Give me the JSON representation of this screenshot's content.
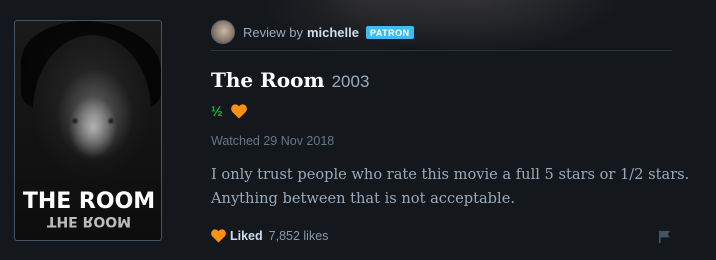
{
  "poster": {
    "title": "THE ROOM",
    "mirrored_title": "THE ROOM"
  },
  "review": {
    "by_label": "Review by",
    "reviewer": "michelle",
    "badge": "PATRON",
    "film_title": "The Room",
    "film_year": "2003",
    "rating_text": "½",
    "rating_stars": 0.5,
    "liked_icon": "heart-icon",
    "watched": "Watched 29 Nov 2018",
    "body": "I only trust people who rate this movie a full 5 stars or 1/2 stars. Anything between that is not acceptable.",
    "liked_label": "Liked",
    "likes": "7,852 likes",
    "report_icon": "flag-icon"
  },
  "colors": {
    "background": "#14181c",
    "accent_green": "#00c030",
    "accent_orange": "#ff9010",
    "patron_badge": "#40bcf4"
  }
}
